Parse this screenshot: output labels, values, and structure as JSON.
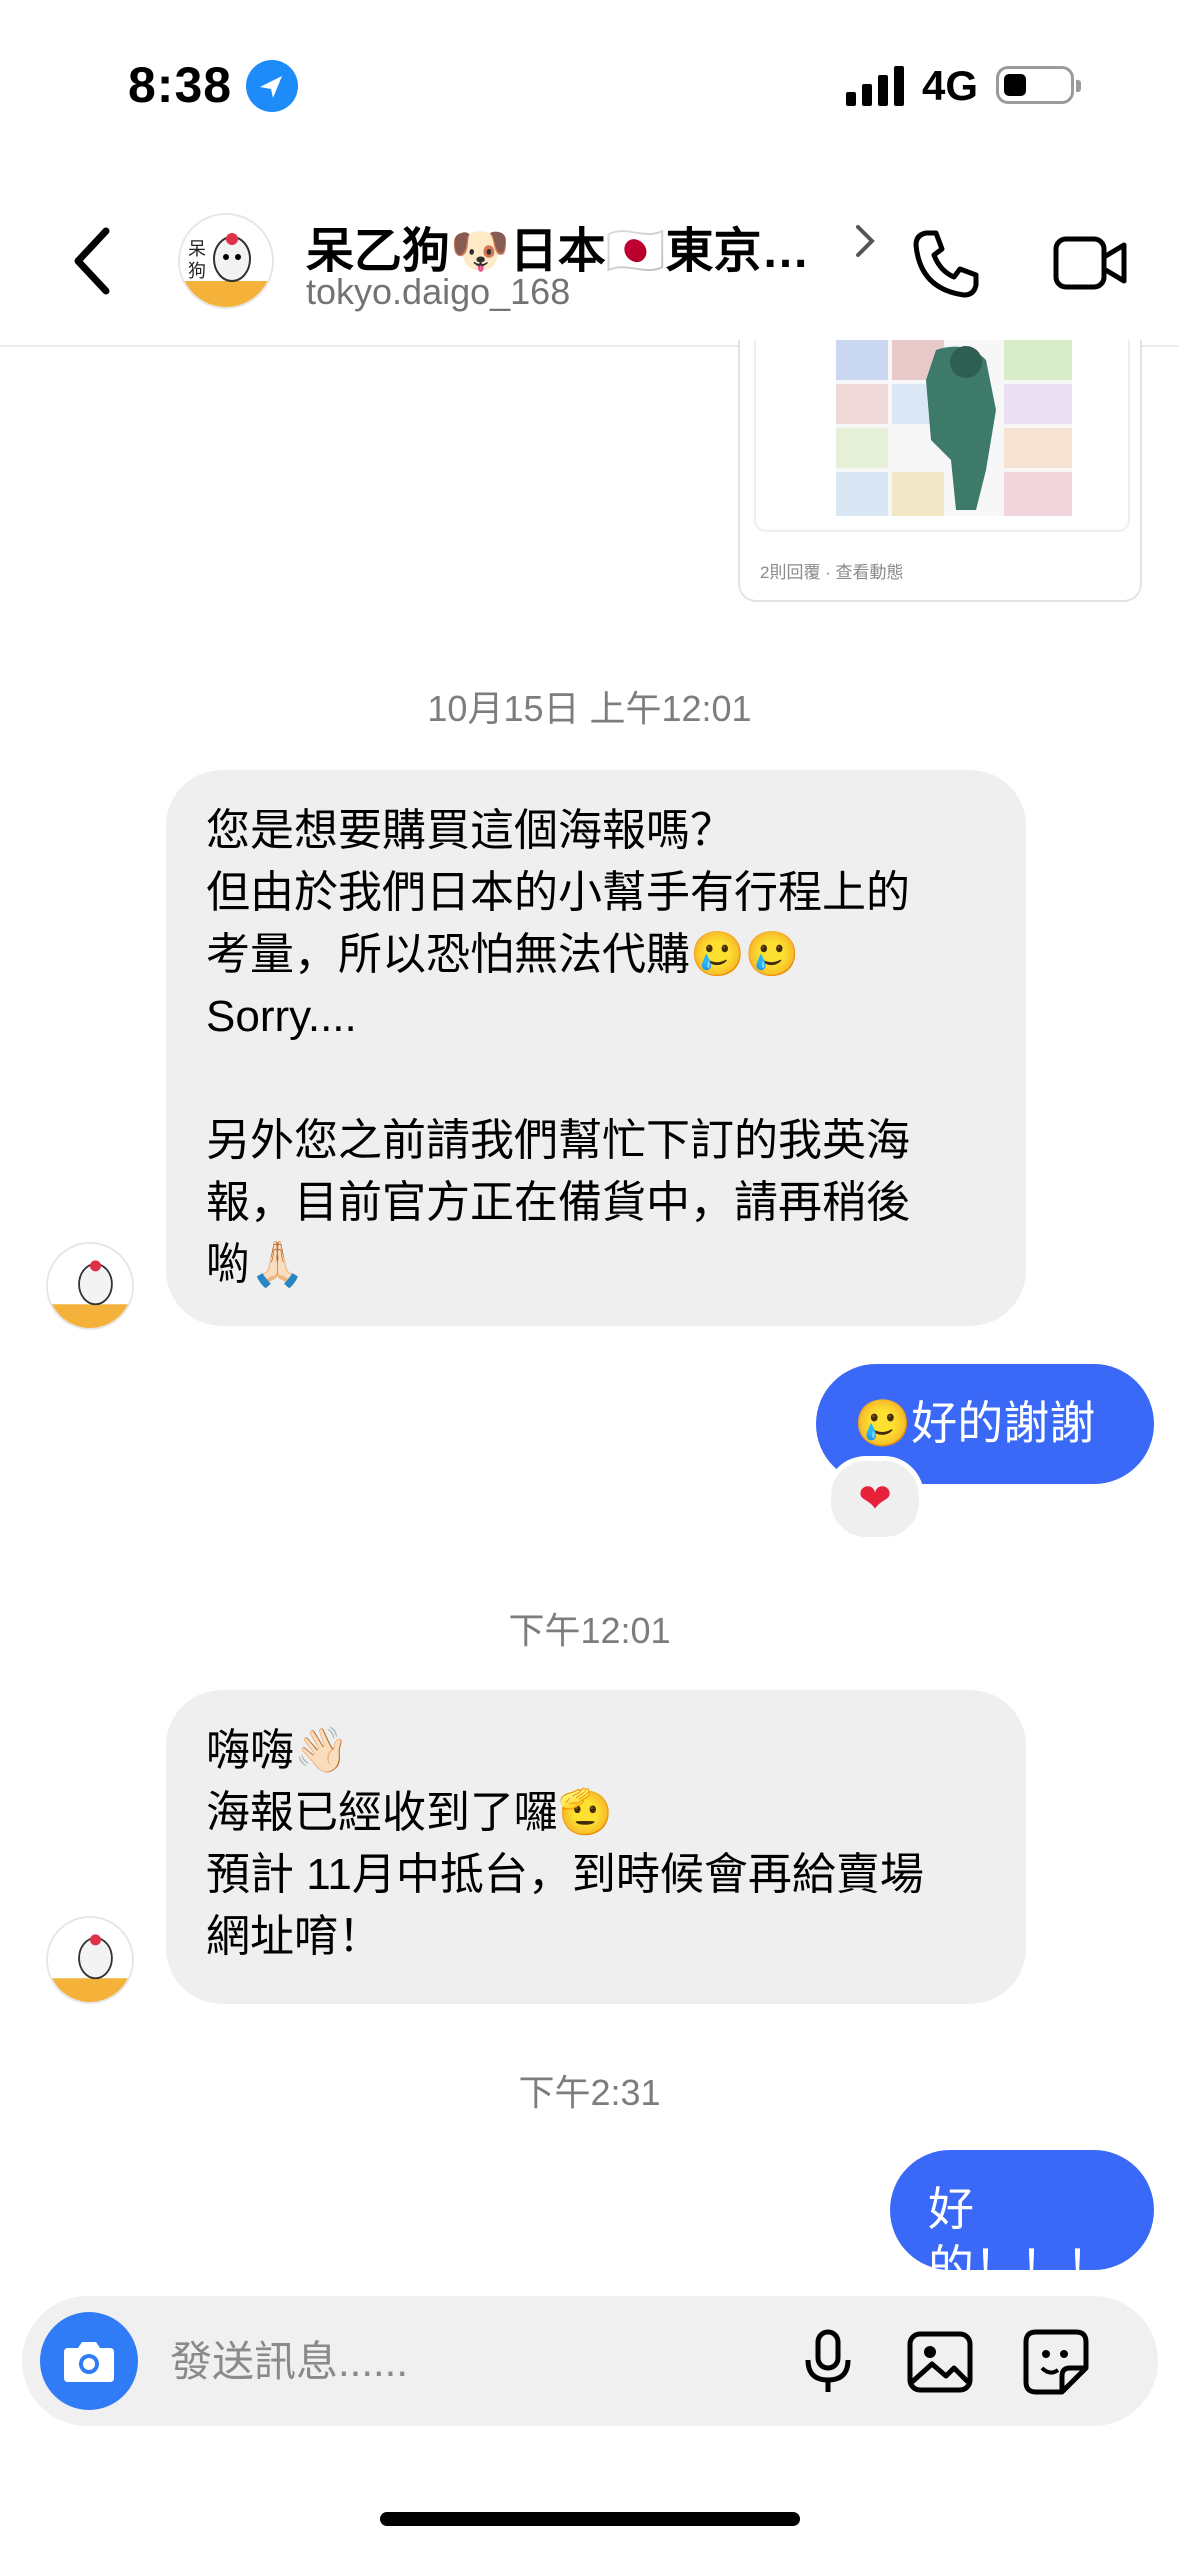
{
  "status_bar": {
    "time": "8:38",
    "network": "4G"
  },
  "header": {
    "name": "呆乙狗🐶日本🇯🇵東京…",
    "username": "tokyo.daigo_168",
    "avatar_text": "呆乙狗"
  },
  "post_preview": {
    "meta": "2則回覆 · 查看動態"
  },
  "messages": [
    {
      "type": "timestamp",
      "text": "10月15日 上午12:01"
    },
    {
      "type": "incoming",
      "text": "您是想要購買這個海報嗎？\n但由於我們日本的小幫手有行程上的\n考量，所以恐怕無法代購🥲🥲\nSorry....\n\n另外您之前請我們幫忙下訂的我英海\n報，目前官方正在備貨中，請再稍後\n喲🙏🏻"
    },
    {
      "type": "outgoing",
      "text": "🥲好的謝謝",
      "reaction": "❤"
    },
    {
      "type": "timestamp",
      "text": "下午12:01"
    },
    {
      "type": "incoming",
      "text": "嗨嗨👋🏻\n海報已經收到了囉🫡\n預計 11月中抵台，到時候會再給賣場\n網址唷！"
    },
    {
      "type": "timestamp",
      "text": "下午2:31"
    },
    {
      "type": "outgoing",
      "text": "好的！！！"
    }
  ],
  "composer": {
    "placeholder": "發送訊息......"
  },
  "colors": {
    "outgoing_bubble": "#3a69f7",
    "incoming_bubble": "#efefef",
    "accent": "#2f7cf6"
  }
}
